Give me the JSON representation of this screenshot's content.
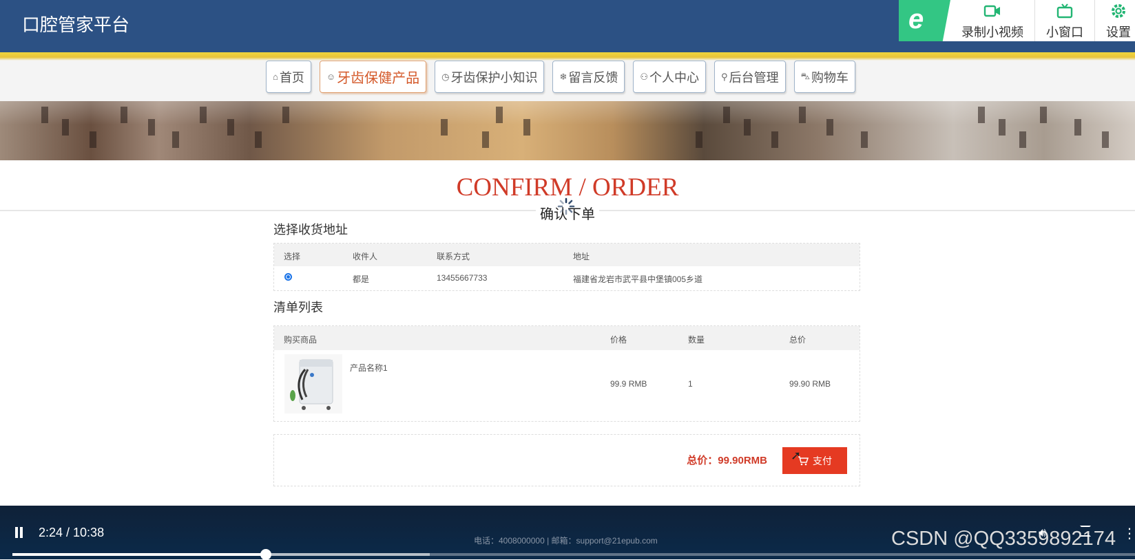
{
  "app": {
    "title": "口腔管家平台"
  },
  "tools": {
    "logo_glyph": "e",
    "record_label": "录制小视频",
    "window_label": "小窗口",
    "settings_label": "设置",
    "accent_color": "#33c684"
  },
  "nav": {
    "items": [
      {
        "icon": "⌂",
        "label": "首页"
      },
      {
        "icon": "☺",
        "label": "牙齿保健产品"
      },
      {
        "icon": "◷",
        "label": "牙齿保护小知识"
      },
      {
        "icon": "❄",
        "label": "留言反馈"
      },
      {
        "icon": "⚇",
        "label": "个人中心"
      },
      {
        "icon": "⚲",
        "label": "后台管理"
      },
      {
        "icon": "⛍",
        "label": "购物车"
      }
    ],
    "active_index": 1
  },
  "page": {
    "en_title": "CONFIRM / ORDER",
    "cn_title": "确认下单"
  },
  "address": {
    "heading": "选择收货地址",
    "columns": [
      "选择",
      "收件人",
      "联系方式",
      "地址"
    ],
    "rows": [
      {
        "selected": true,
        "name": "都是",
        "phone": "13455667733",
        "address": "福建省龙岩市武平县中堡镇005乡道"
      }
    ]
  },
  "order": {
    "heading": "清单列表",
    "columns": [
      "购买商品",
      "价格",
      "数量",
      "总价"
    ],
    "items": [
      {
        "name": "产品名称1",
        "price": "99.9 RMB",
        "qty": "1",
        "total": "99.90 RMB"
      }
    ]
  },
  "summary": {
    "total_label": "总价：99.90RMB",
    "pay_label": "支付"
  },
  "player": {
    "time": "2:24 / 10:38",
    "progress": 0.2256,
    "buffered": 0.372,
    "footer": "电话：4008000000 | 邮箱：support@21epub.com",
    "watermark": "CSDN @QQ3359892174"
  }
}
